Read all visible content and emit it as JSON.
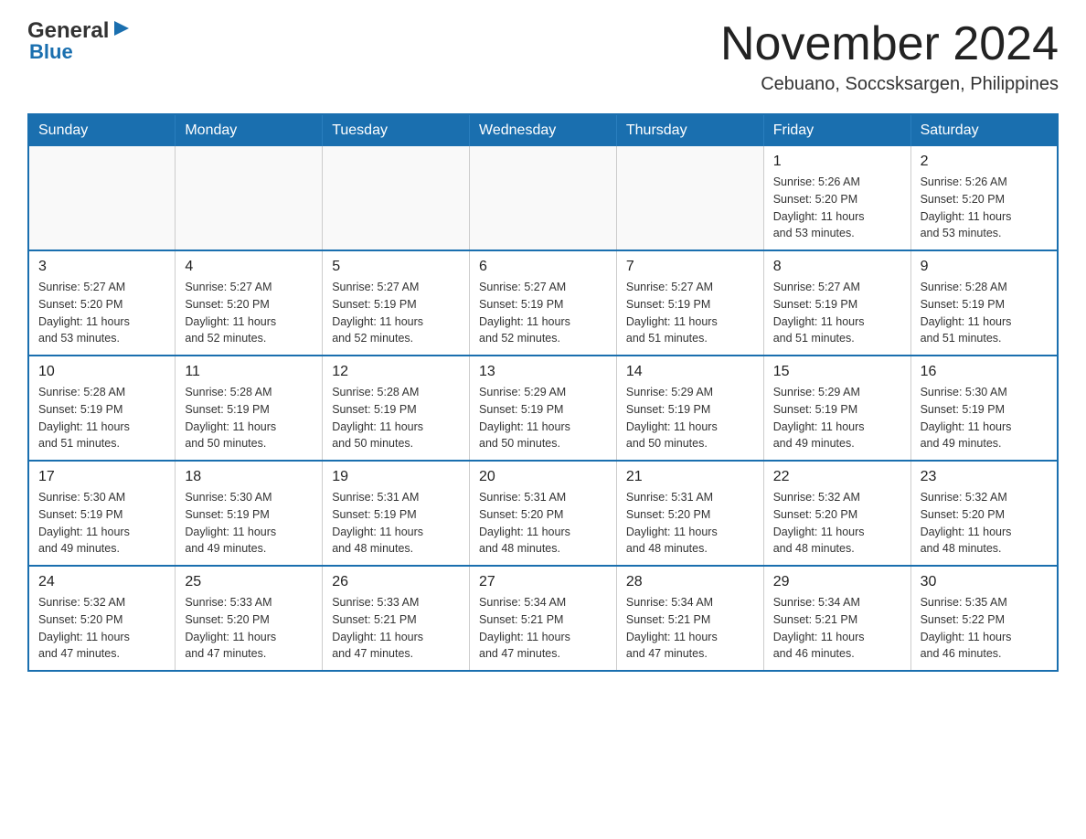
{
  "header": {
    "logo_general": "General",
    "logo_blue": "Blue",
    "month_title": "November 2024",
    "subtitle": "Cebuano, Soccsksargen, Philippines"
  },
  "calendar": {
    "days_of_week": [
      "Sunday",
      "Monday",
      "Tuesday",
      "Wednesday",
      "Thursday",
      "Friday",
      "Saturday"
    ],
    "weeks": [
      [
        {
          "day": "",
          "info": ""
        },
        {
          "day": "",
          "info": ""
        },
        {
          "day": "",
          "info": ""
        },
        {
          "day": "",
          "info": ""
        },
        {
          "day": "",
          "info": ""
        },
        {
          "day": "1",
          "info": "Sunrise: 5:26 AM\nSunset: 5:20 PM\nDaylight: 11 hours\nand 53 minutes."
        },
        {
          "day": "2",
          "info": "Sunrise: 5:26 AM\nSunset: 5:20 PM\nDaylight: 11 hours\nand 53 minutes."
        }
      ],
      [
        {
          "day": "3",
          "info": "Sunrise: 5:27 AM\nSunset: 5:20 PM\nDaylight: 11 hours\nand 53 minutes."
        },
        {
          "day": "4",
          "info": "Sunrise: 5:27 AM\nSunset: 5:20 PM\nDaylight: 11 hours\nand 52 minutes."
        },
        {
          "day": "5",
          "info": "Sunrise: 5:27 AM\nSunset: 5:19 PM\nDaylight: 11 hours\nand 52 minutes."
        },
        {
          "day": "6",
          "info": "Sunrise: 5:27 AM\nSunset: 5:19 PM\nDaylight: 11 hours\nand 52 minutes."
        },
        {
          "day": "7",
          "info": "Sunrise: 5:27 AM\nSunset: 5:19 PM\nDaylight: 11 hours\nand 51 minutes."
        },
        {
          "day": "8",
          "info": "Sunrise: 5:27 AM\nSunset: 5:19 PM\nDaylight: 11 hours\nand 51 minutes."
        },
        {
          "day": "9",
          "info": "Sunrise: 5:28 AM\nSunset: 5:19 PM\nDaylight: 11 hours\nand 51 minutes."
        }
      ],
      [
        {
          "day": "10",
          "info": "Sunrise: 5:28 AM\nSunset: 5:19 PM\nDaylight: 11 hours\nand 51 minutes."
        },
        {
          "day": "11",
          "info": "Sunrise: 5:28 AM\nSunset: 5:19 PM\nDaylight: 11 hours\nand 50 minutes."
        },
        {
          "day": "12",
          "info": "Sunrise: 5:28 AM\nSunset: 5:19 PM\nDaylight: 11 hours\nand 50 minutes."
        },
        {
          "day": "13",
          "info": "Sunrise: 5:29 AM\nSunset: 5:19 PM\nDaylight: 11 hours\nand 50 minutes."
        },
        {
          "day": "14",
          "info": "Sunrise: 5:29 AM\nSunset: 5:19 PM\nDaylight: 11 hours\nand 50 minutes."
        },
        {
          "day": "15",
          "info": "Sunrise: 5:29 AM\nSunset: 5:19 PM\nDaylight: 11 hours\nand 49 minutes."
        },
        {
          "day": "16",
          "info": "Sunrise: 5:30 AM\nSunset: 5:19 PM\nDaylight: 11 hours\nand 49 minutes."
        }
      ],
      [
        {
          "day": "17",
          "info": "Sunrise: 5:30 AM\nSunset: 5:19 PM\nDaylight: 11 hours\nand 49 minutes."
        },
        {
          "day": "18",
          "info": "Sunrise: 5:30 AM\nSunset: 5:19 PM\nDaylight: 11 hours\nand 49 minutes."
        },
        {
          "day": "19",
          "info": "Sunrise: 5:31 AM\nSunset: 5:19 PM\nDaylight: 11 hours\nand 48 minutes."
        },
        {
          "day": "20",
          "info": "Sunrise: 5:31 AM\nSunset: 5:20 PM\nDaylight: 11 hours\nand 48 minutes."
        },
        {
          "day": "21",
          "info": "Sunrise: 5:31 AM\nSunset: 5:20 PM\nDaylight: 11 hours\nand 48 minutes."
        },
        {
          "day": "22",
          "info": "Sunrise: 5:32 AM\nSunset: 5:20 PM\nDaylight: 11 hours\nand 48 minutes."
        },
        {
          "day": "23",
          "info": "Sunrise: 5:32 AM\nSunset: 5:20 PM\nDaylight: 11 hours\nand 48 minutes."
        }
      ],
      [
        {
          "day": "24",
          "info": "Sunrise: 5:32 AM\nSunset: 5:20 PM\nDaylight: 11 hours\nand 47 minutes."
        },
        {
          "day": "25",
          "info": "Sunrise: 5:33 AM\nSunset: 5:20 PM\nDaylight: 11 hours\nand 47 minutes."
        },
        {
          "day": "26",
          "info": "Sunrise: 5:33 AM\nSunset: 5:21 PM\nDaylight: 11 hours\nand 47 minutes."
        },
        {
          "day": "27",
          "info": "Sunrise: 5:34 AM\nSunset: 5:21 PM\nDaylight: 11 hours\nand 47 minutes."
        },
        {
          "day": "28",
          "info": "Sunrise: 5:34 AM\nSunset: 5:21 PM\nDaylight: 11 hours\nand 47 minutes."
        },
        {
          "day": "29",
          "info": "Sunrise: 5:34 AM\nSunset: 5:21 PM\nDaylight: 11 hours\nand 46 minutes."
        },
        {
          "day": "30",
          "info": "Sunrise: 5:35 AM\nSunset: 5:22 PM\nDaylight: 11 hours\nand 46 minutes."
        }
      ]
    ]
  }
}
